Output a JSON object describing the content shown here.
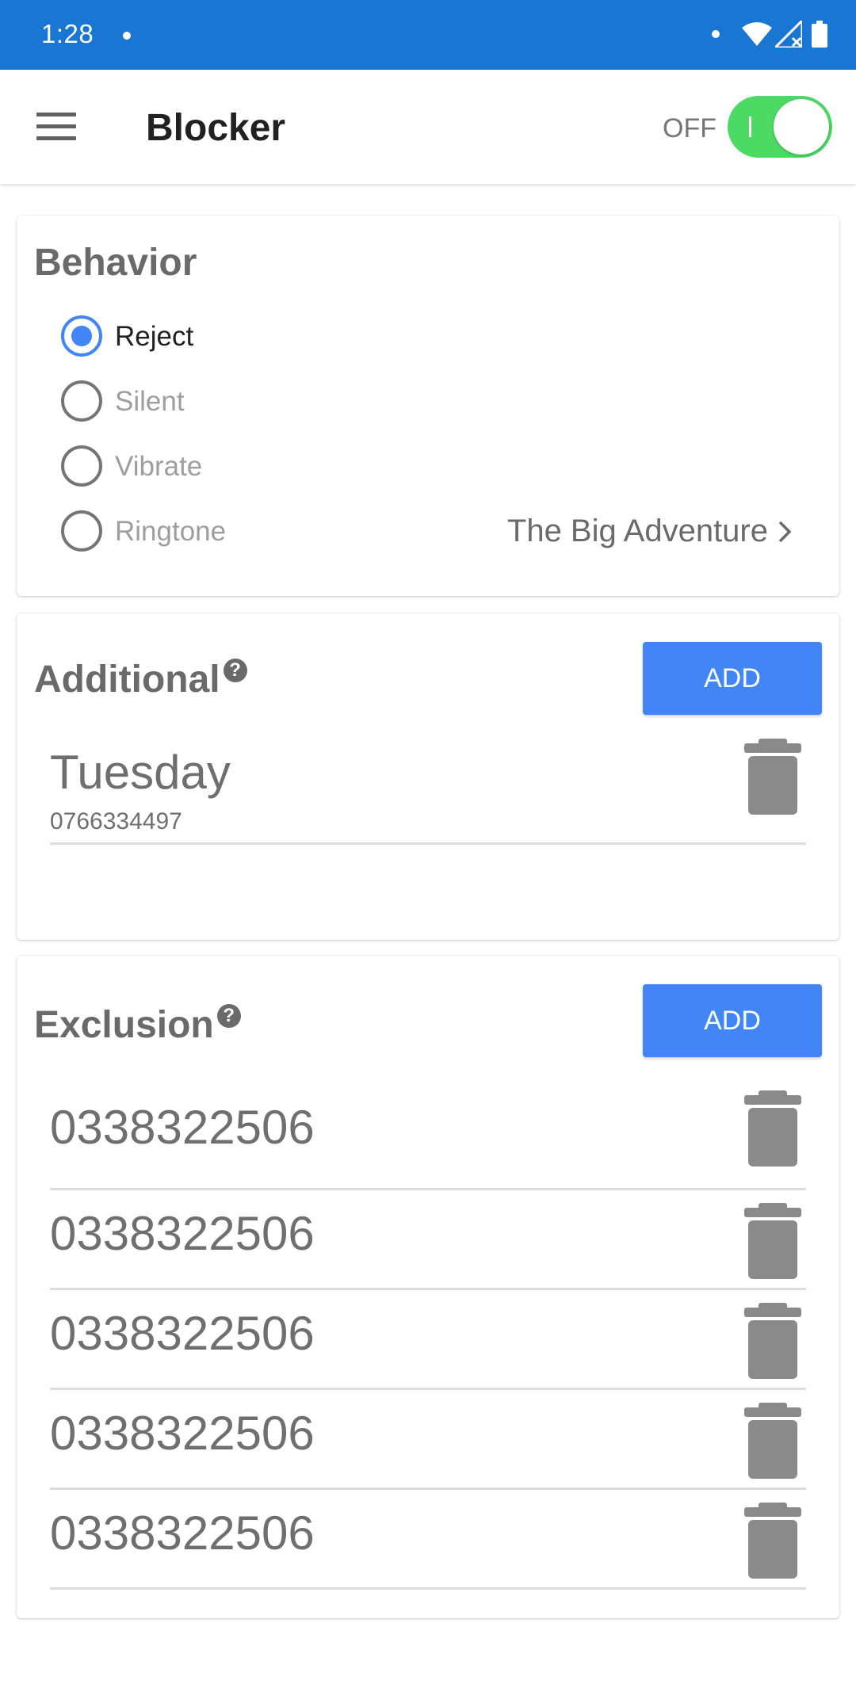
{
  "status_bar": {
    "time": "1:28"
  },
  "app_bar": {
    "title": "Blocker",
    "toggle_label": "OFF"
  },
  "behavior": {
    "title": "Behavior",
    "options": [
      {
        "label": "Reject",
        "selected": true
      },
      {
        "label": "Silent",
        "selected": false
      },
      {
        "label": "Vibrate",
        "selected": false
      },
      {
        "label": "Ringtone",
        "selected": false
      }
    ],
    "ringtone_value": "The Big Adventure"
  },
  "additional": {
    "title": "Additional",
    "help_icon": "?",
    "add_label": "ADD",
    "entries": [
      {
        "name": "Tuesday",
        "number": "0766334497"
      }
    ]
  },
  "exclusion": {
    "title": "Exclusion",
    "help_icon": "?",
    "add_label": "ADD",
    "entries": [
      {
        "number": "0338322506"
      },
      {
        "number": "0338322506"
      },
      {
        "number": "0338322506"
      },
      {
        "number": "0338322506"
      },
      {
        "number": "0338322506"
      }
    ]
  },
  "colors": {
    "status_bar": "#1976d2",
    "accent": "#4285f4",
    "toggle": "#4cd964"
  }
}
